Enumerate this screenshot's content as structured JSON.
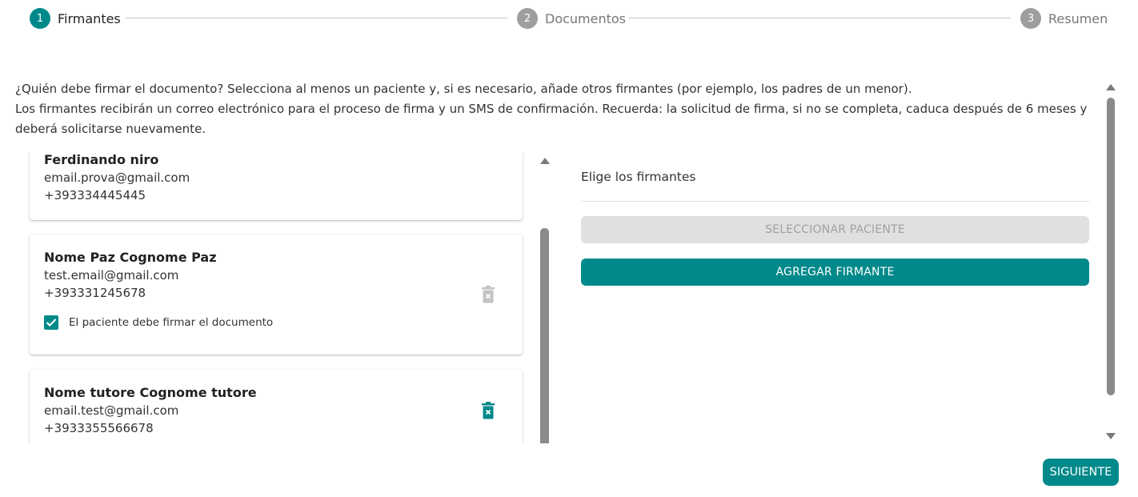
{
  "stepper": {
    "steps": [
      {
        "number": "1",
        "label": "Firmantes"
      },
      {
        "number": "2",
        "label": "Documentos"
      },
      {
        "number": "3",
        "label": "Resumen"
      }
    ]
  },
  "intro": {
    "line1": "¿Quién debe firmar el documento? Selecciona al menos un paciente y, si es necesario, añade otros firmantes (por ejemplo, los padres de un menor).",
    "line2": "Los firmantes recibirán un correo electrónico para el proceso de firma y un SMS de confirmación. Recuerda: la solicitud de firma, si no se completa, caduca después de 6 meses y deberá solicitarse nuevamente."
  },
  "signers": [
    {
      "name": "Ferdinando niro",
      "email": "email.prova@gmail.com",
      "phone": "+393334445445"
    },
    {
      "name": "Nome Paz Cognome Paz",
      "email": "test.email@gmail.com",
      "phone": "+393331245678",
      "checkbox_label": "El paciente debe firmar el documento"
    },
    {
      "name": "Nome tutore Cognome tutore",
      "email": "email.test@gmail.com",
      "phone": "+3933355566678"
    }
  ],
  "right_panel": {
    "title": "Elige los firmantes",
    "select_patient_label": "SELECCIONAR PACIENTE",
    "add_signer_label": "AGREGAR FIRMANTE"
  },
  "footer": {
    "next_label": "SIGUIENTE"
  },
  "colors": {
    "accent": "#00898a",
    "disabled": "#e0e0e0",
    "inactive_step": "#9e9e9e"
  }
}
